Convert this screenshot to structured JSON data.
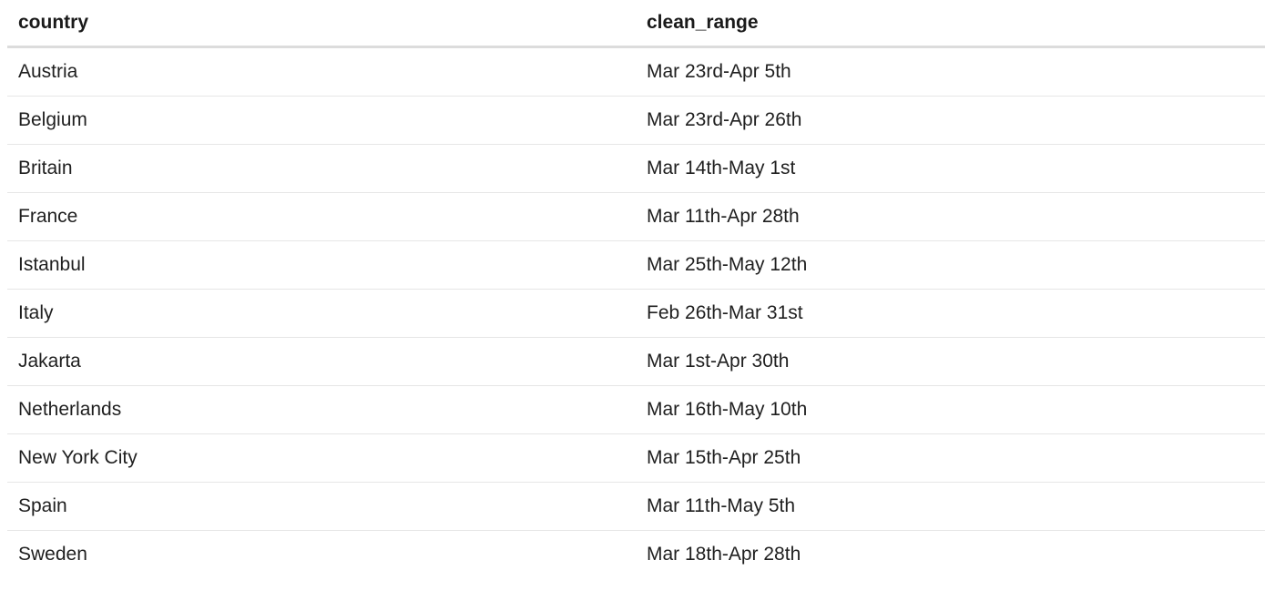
{
  "table": {
    "headers": [
      "country",
      "clean_range"
    ],
    "rows": [
      [
        "Austria",
        "Mar 23rd-Apr 5th"
      ],
      [
        "Belgium",
        "Mar 23rd-Apr 26th"
      ],
      [
        "Britain",
        "Mar 14th-May 1st"
      ],
      [
        "France",
        "Mar 11th-Apr 28th"
      ],
      [
        "Istanbul",
        "Mar 25th-May 12th"
      ],
      [
        "Italy",
        "Feb 26th-Mar 31st"
      ],
      [
        "Jakarta",
        "Mar 1st-Apr 30th"
      ],
      [
        "Netherlands",
        "Mar 16th-May 10th"
      ],
      [
        "New York City",
        "Mar 15th-Apr 25th"
      ],
      [
        "Spain",
        "Mar 11th-May 5th"
      ],
      [
        "Sweden",
        "Mar 18th-Apr 28th"
      ]
    ]
  }
}
